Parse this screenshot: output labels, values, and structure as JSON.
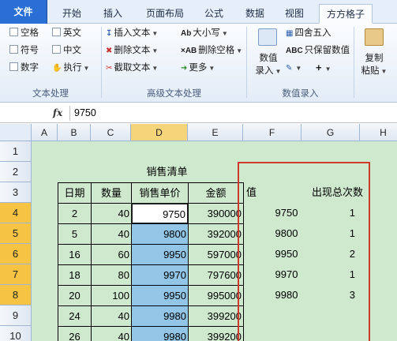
{
  "tabs": [
    "文件",
    "开始",
    "插入",
    "页面布局",
    "公式",
    "数据",
    "视图",
    "方方格子"
  ],
  "ribbon": {
    "text_group": {
      "checkboxes": [
        "空格",
        "英文",
        "符号",
        "中文",
        "数字"
      ],
      "execute": "执行",
      "label": "文本处理"
    },
    "advanced_group": {
      "items": [
        "插入文本",
        "删除文本",
        "截取文本",
        "大小写",
        "删除空格",
        "更多"
      ],
      "label": "高级文本处理"
    },
    "number_group": {
      "value_entry": [
        "数值",
        "录入"
      ],
      "items": [
        "四舍五入",
        "只保留数值"
      ],
      "label": "数值录入"
    },
    "paste_group": {
      "label_lines": [
        "复制",
        "粘贴"
      ]
    },
    "icons": [
      "insert-text-icon",
      "delete-text-icon",
      "extract-text-icon",
      "case-icon",
      "remove-space-icon",
      "more-icon",
      "value-entry-icon",
      "round-icon",
      "keep-value-icon",
      "copy-paste-icon",
      "execute-icon"
    ]
  },
  "formula_bar": {
    "fx": "fx",
    "value": "9750"
  },
  "sheet": {
    "columns": [
      "A",
      "B",
      "C",
      "D",
      "E",
      "F",
      "G",
      "H"
    ],
    "selected_column": "D",
    "rows": [
      "1",
      "2",
      "3",
      "4",
      "5",
      "6",
      "7",
      "8",
      "9",
      "10"
    ],
    "selected_rows": [
      "4",
      "5",
      "6",
      "7",
      "8"
    ],
    "title": "销售清单",
    "headers": [
      "日期",
      "数量",
      "销售单价",
      "金额"
    ],
    "data": [
      [
        "2",
        "40",
        "9750",
        "390000"
      ],
      [
        "5",
        "40",
        "9800",
        "392000"
      ],
      [
        "16",
        "60",
        "9950",
        "597000"
      ],
      [
        "18",
        "80",
        "9970",
        "797600"
      ],
      [
        "20",
        "100",
        "9950",
        "995000"
      ],
      [
        "24",
        "40",
        "9980",
        "399200"
      ],
      [
        "26",
        "40",
        "9980",
        "399200"
      ]
    ],
    "side_headers": [
      "值",
      "出现总次数"
    ],
    "side_data": [
      [
        "9750",
        "1"
      ],
      [
        "9800",
        "1"
      ],
      [
        "9950",
        "2"
      ],
      [
        "9970",
        "1"
      ],
      [
        "9980",
        "3"
      ]
    ]
  },
  "colors": {
    "sheet_bg": "#cfe9cf",
    "highlight": "#92c5e6",
    "red_box": "#d03a2a",
    "file_tab": "#2a6fd5"
  }
}
